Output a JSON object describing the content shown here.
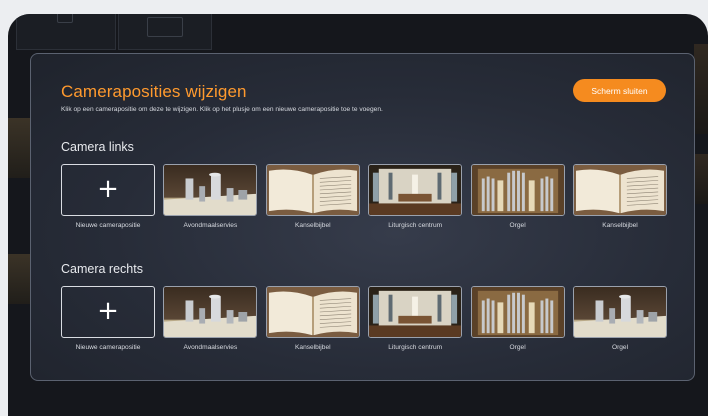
{
  "modal": {
    "title": "Cameraposities wijzigen",
    "subtitle": "Klik op een camerapositie om deze te wijzigen. Klik op het plusje om een nieuwe camerapositie toe te voegen.",
    "close_label": "Scherm sluiten",
    "accent_color": "#f58b1f"
  },
  "sections": [
    {
      "title": "Camera links",
      "tiles": [
        {
          "label": "Nieuwe camerapositie",
          "kind": "new",
          "icon": "plus-icon"
        },
        {
          "label": "Avondmaalservies",
          "kind": "communion"
        },
        {
          "label": "Kanselbijbel",
          "kind": "bible"
        },
        {
          "label": "Liturgisch centrum",
          "kind": "church"
        },
        {
          "label": "Orgel",
          "kind": "organ"
        },
        {
          "label": "Kanselbijbel",
          "kind": "bible"
        }
      ]
    },
    {
      "title": "Camera rechts",
      "tiles": [
        {
          "label": "Nieuwe camerapositie",
          "kind": "new",
          "icon": "plus-icon"
        },
        {
          "label": "Avondmaalservies",
          "kind": "communion"
        },
        {
          "label": "Kanselbijbel",
          "kind": "bible"
        },
        {
          "label": "Liturgisch centrum",
          "kind": "church"
        },
        {
          "label": "Orgel",
          "kind": "organ"
        },
        {
          "label": "Orgel",
          "kind": "communion"
        }
      ]
    }
  ]
}
